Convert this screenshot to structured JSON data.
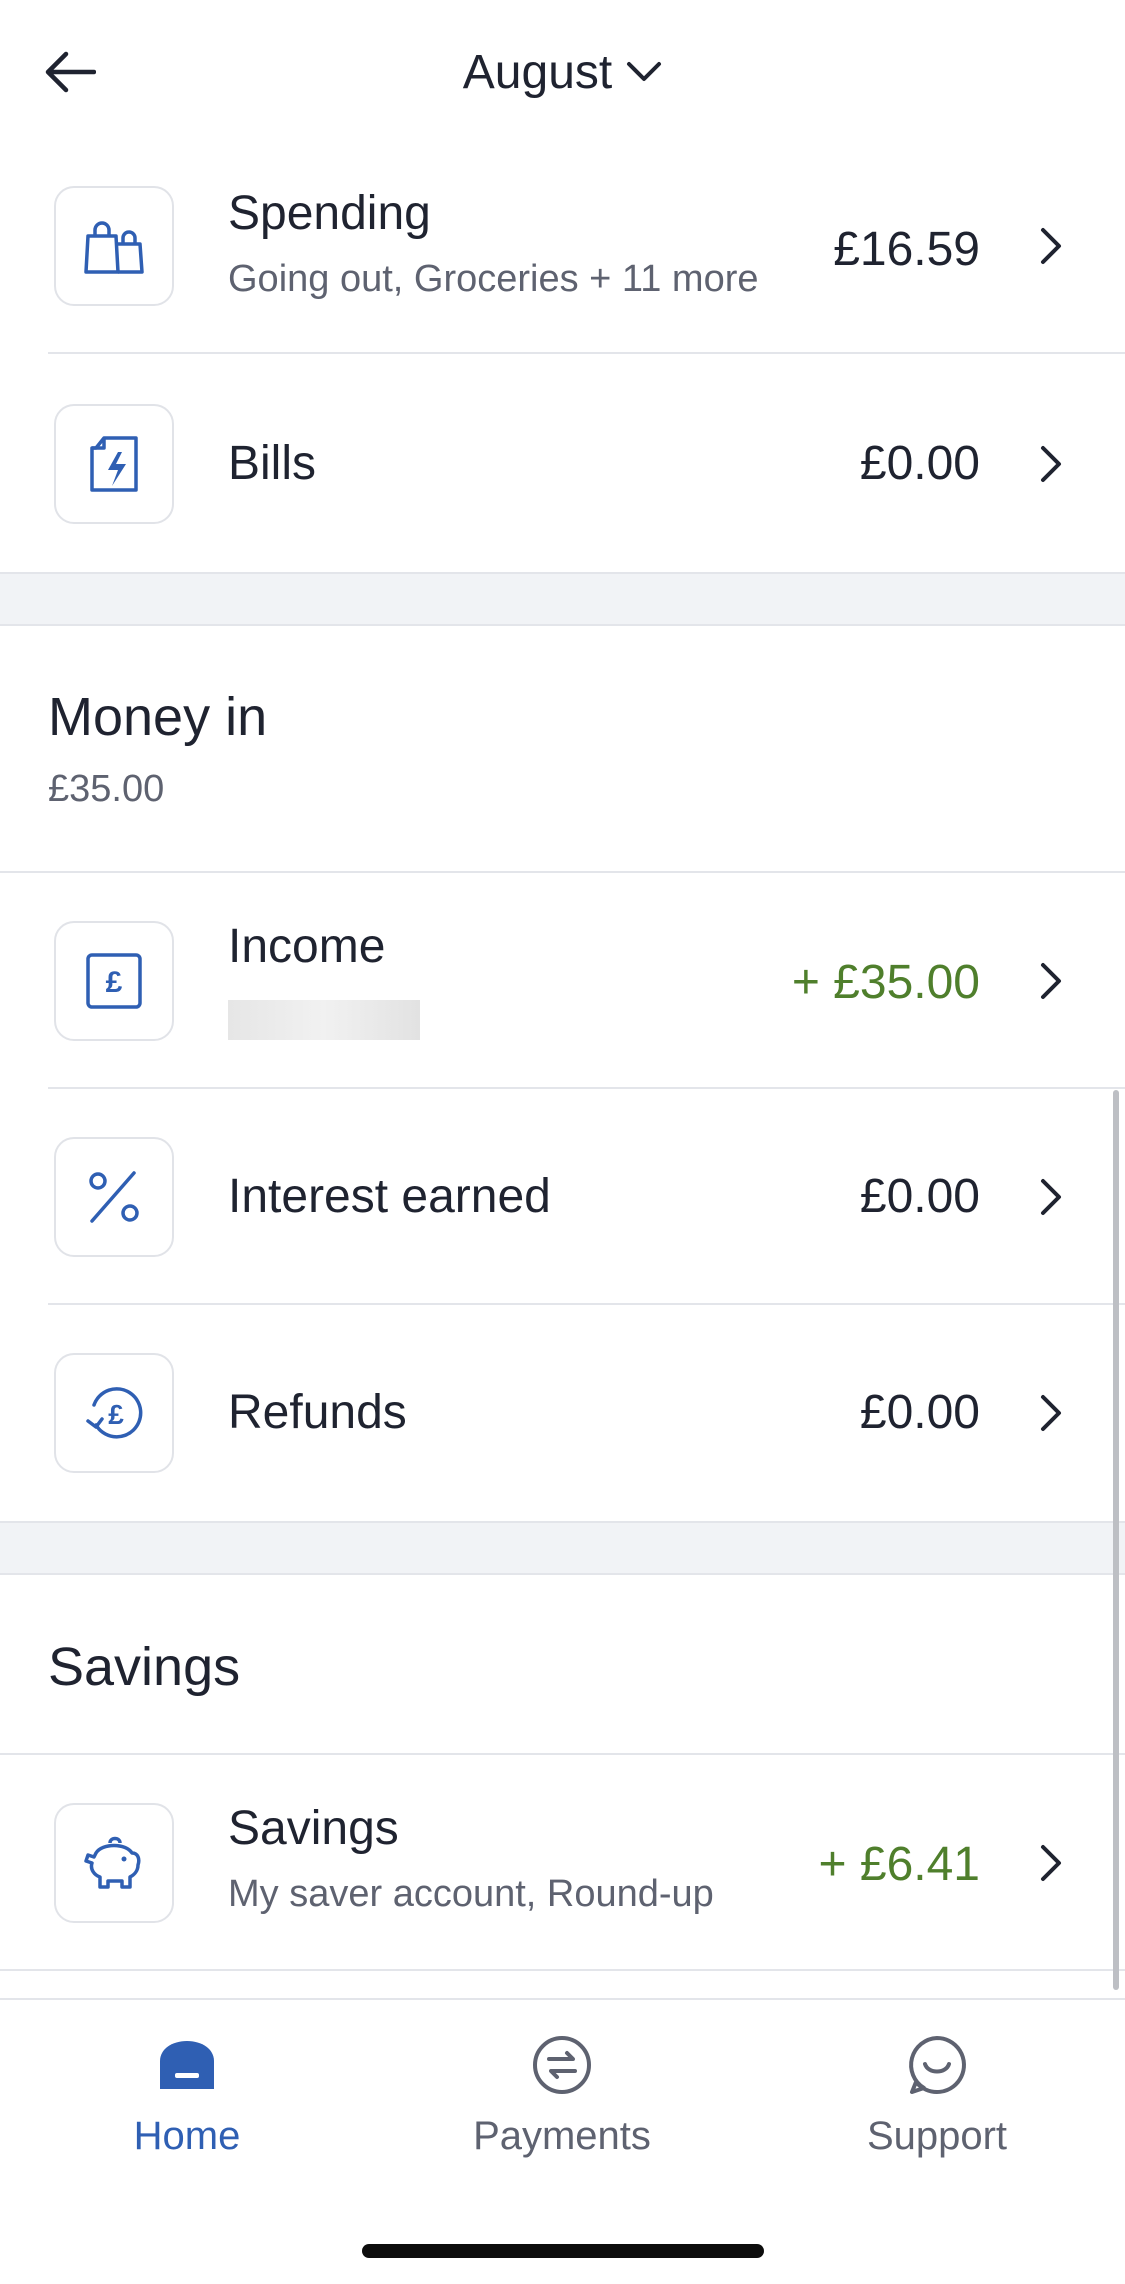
{
  "header": {
    "month": "August"
  },
  "money_out_rows": [
    {
      "title": "Spending",
      "subtitle": "Going out, Groceries + 11 more",
      "amount": "£16.59",
      "icon": "shopping-bags-icon"
    },
    {
      "title": "Bills",
      "amount": "£0.00",
      "icon": "bill-lightning-icon"
    }
  ],
  "money_in": {
    "title": "Money in",
    "total": "£35.00",
    "rows": [
      {
        "title": "Income",
        "amount": "+ £35.00",
        "icon": "pound-card-icon"
      },
      {
        "title": "Interest earned",
        "amount": "£0.00",
        "icon": "percent-icon"
      },
      {
        "title": "Refunds",
        "amount": "£0.00",
        "icon": "refund-pound-icon"
      }
    ]
  },
  "savings": {
    "title": "Savings",
    "rows": [
      {
        "title": "Savings",
        "subtitle": "My saver account, Round-up",
        "amount": "+ £6.41",
        "icon": "piggy-bank-icon"
      }
    ]
  },
  "tabs": [
    {
      "label": "Home",
      "icon": "home-icon",
      "active": true
    },
    {
      "label": "Payments",
      "icon": "payments-icon",
      "active": false
    },
    {
      "label": "Support",
      "icon": "support-chat-icon",
      "active": false
    }
  ],
  "colors": {
    "accent": "#2f5fb3",
    "positive": "#4f7f2c",
    "text": "#1f2330",
    "muted": "#5e6270"
  }
}
